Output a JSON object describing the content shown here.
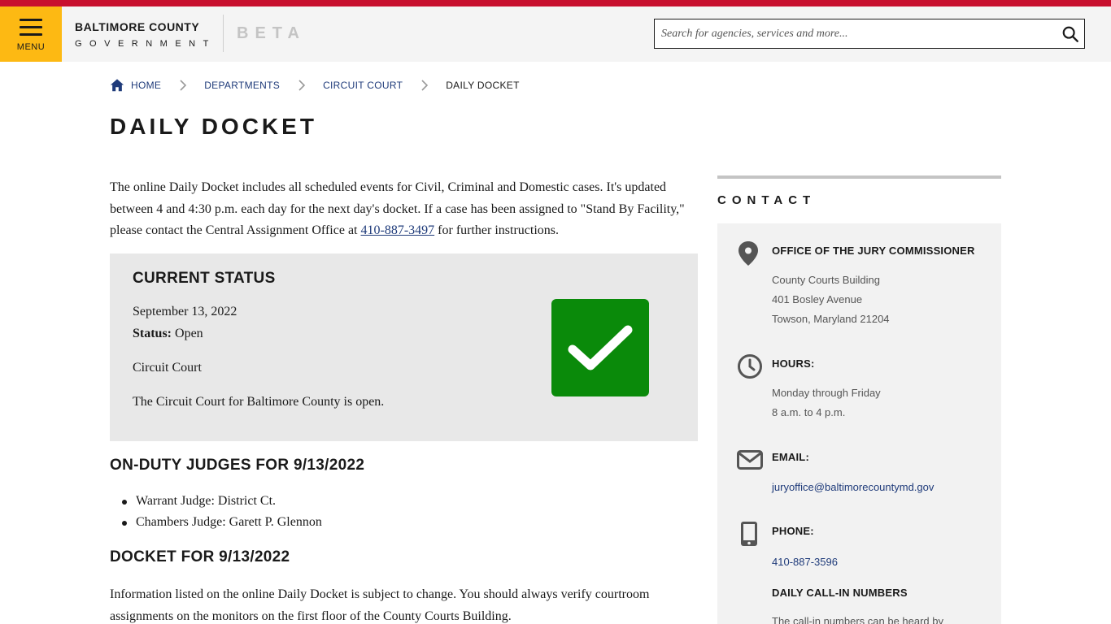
{
  "header": {
    "menu_label": "MENU",
    "brand_line1": "BALTIMORE COUNTY",
    "brand_line2": "GOVERNMENT",
    "beta_label": "BETA",
    "search_placeholder": "Search for agencies, services and more...",
    "accent_color": "#fdb913",
    "topbar_color": "#c8102e"
  },
  "breadcrumb": [
    {
      "label": "HOME",
      "icon": "home-icon"
    },
    {
      "label": "DEPARTMENTS"
    },
    {
      "label": "CIRCUIT COURT"
    },
    {
      "label": "DAILY DOCKET"
    }
  ],
  "page": {
    "title": "DAILY DOCKET",
    "intro_before_phone": "The online Daily Docket includes all scheduled events for Civil, Criminal and Domestic cases. It's updated between 4 and 4:30 p.m. each day for the next day's docket. If a case has been assigned to \"Stand By Facility,\" please contact the Central Assignment Office at ",
    "intro_phone": "410-887-3497",
    "intro_after_phone": " for further instructions."
  },
  "status": {
    "heading": "CURRENT STATUS",
    "date": "September 13, 2022",
    "status_label": "Status:",
    "status_value": "Open",
    "court": "Circuit Court",
    "message": "The Circuit Court for Baltimore County is open.",
    "icon": "checkmark-icon",
    "tile_color": "#0a8a0a"
  },
  "judges": {
    "heading": "ON-DUTY JUDGES FOR 9/13/2022",
    "items": [
      "Warrant Judge: District Ct.",
      "Chambers Judge: Garett P. Glennon"
    ]
  },
  "docket": {
    "heading": "DOCKET FOR 9/13/2022",
    "text": "Information listed on the online Daily Docket is subject to change. You should always verify courtroom assignments on the monitors on the first floor of the County Courts Building."
  },
  "contact": {
    "heading": "CONTACT",
    "office": {
      "label": "OFFICE OF THE JURY COMMISSIONER",
      "icon": "map-pin-icon",
      "address": [
        "County Courts Building",
        "401 Bosley Avenue",
        "Towson, Maryland 21204"
      ]
    },
    "hours": {
      "label": "HOURS:",
      "icon": "clock-icon",
      "lines": [
        "Monday through Friday",
        "8 a.m. to 4 p.m."
      ]
    },
    "email": {
      "label": "EMAIL:",
      "icon": "envelope-icon",
      "value": "juryoffice@baltimorecountymd.gov"
    },
    "phone": {
      "label": "PHONE:",
      "icon": "mobile-phone-icon",
      "value": "410-887-3596"
    },
    "callin": {
      "label": "DAILY CALL-IN NUMBERS",
      "text": "The call-in numbers can be heard by"
    }
  }
}
